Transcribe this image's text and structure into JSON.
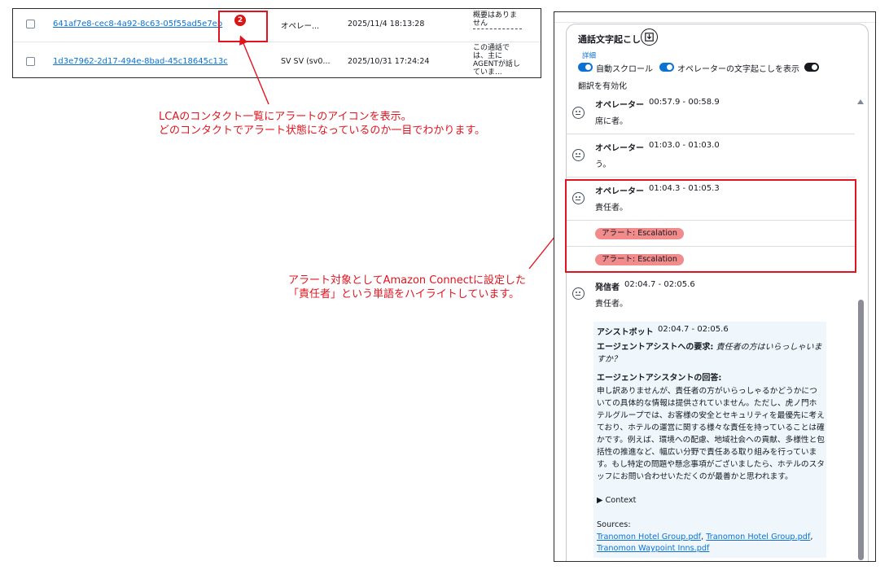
{
  "contacts": [
    {
      "id": "641af7e8-cec8-4a92-8c63-05f55ad5e7eb",
      "alert_count": "2",
      "agent": "オペレー...",
      "time": "2025/11/4 18:13:28",
      "summary": "概要はありません"
    },
    {
      "id": "1d3e7962-2d17-494e-8bad-45c18645c13c",
      "agent": "SV SV (sv0...",
      "time": "2025/10/31 17:24:24",
      "summary": "この通話では、主にAGENTが話していま..."
    }
  ],
  "annotations": {
    "note1_line1": "LCAのコンタクト一覧にアラートのアイコンを表示。",
    "note1_line2": "どのコンタクトでアラート状態になっているのか一目でわかります。",
    "note2_line1": "アラート対象としてAmazon Connectに設定した",
    "note2_line2": "「責任者」という単語をハイライトしています。"
  },
  "transcript": {
    "title": "通話文字起こし",
    "details_link": "詳細",
    "toggle_autoscroll": "自動スクロール",
    "toggle_show_operator": "オペレーターの文字起こしを表示",
    "toggle_translate": "翻訳を有効化",
    "messages": [
      {
        "speaker": "オペレーター",
        "time": "00:57.9 - 00:58.9",
        "text": "席に者。"
      },
      {
        "speaker": "オペレーター",
        "time": "01:03.0 - 01:03.0",
        "text": "う。"
      },
      {
        "speaker": "オペレーター",
        "time": "01:04.3 - 01:05.3",
        "text": "責任者。"
      },
      {
        "speaker": "発信者",
        "time": "02:04.7 - 02:05.6",
        "text": "責任者。"
      }
    ],
    "alerts": [
      "アラート: Escalation",
      "アラート: Escalation"
    ],
    "assistant": {
      "speaker": "アシストボット",
      "time": "02:04.7 - 02:05.6",
      "request_label": "エージェントアシストへの要求:",
      "request_text": "責任者の方はいらっしゃいますか？",
      "answer_label": "エージェントアシスタントの回答:",
      "answer_text": "申し訳ありませんが、責任者の方がいらっしゃるかどうかについての具体的な情報は提供されていません。ただし、虎ノ門ホテルグループでは、お客様の安全とセキュリティを最優先に考えており、ホテルの運営に関する様々な責任を持っていることは確かです。例えば、環境への配慮、地域社会への貢献、多様性と包括性の推進など、幅広い分野で責任ある取り組みを行っています。もし特定の問題や懸念事項がございましたら、ホテルのスタッフにお問い合わせいただくのが最善かと思われます。",
      "context_label": "▶ Context",
      "sources_label": "Sources:",
      "sources": [
        "Tranomon Hotel Group.pdf",
        "Tranomon Hotel Group.pdf",
        "Tranomon Waypoint Inns.pdf"
      ]
    }
  },
  "colors": {
    "link": "#0972d3",
    "alert_red": "#e0141e",
    "badge_red": "#d91515",
    "chip_bg": "#f28b8b",
    "assist_bg": "#f0f7fc"
  }
}
